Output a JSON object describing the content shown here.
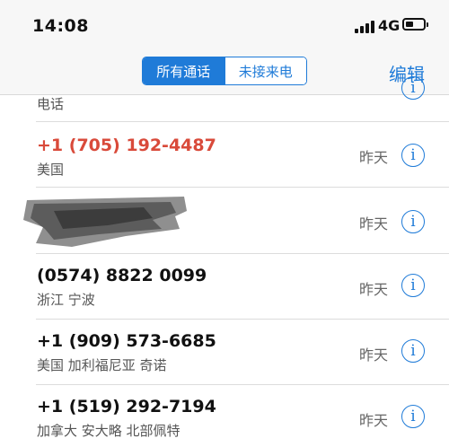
{
  "status_bar": {
    "time": "14:08",
    "network": "4G"
  },
  "nav": {
    "segments": [
      "所有通话",
      "未接来电"
    ],
    "edit_label": "编辑"
  },
  "calls": [
    {
      "number": "",
      "location": "电话",
      "when": "",
      "missed": false
    },
    {
      "number": "+1 (705) 192-4487",
      "location": "美国",
      "when": "昨天",
      "missed": true
    },
    {
      "number": "",
      "location": "",
      "when": "昨天",
      "missed": false
    },
    {
      "number": "(0574) 8822 0099",
      "location": "浙江 宁波",
      "when": "昨天",
      "missed": false
    },
    {
      "number": "+1 (909) 573-6685",
      "location": "美国 加利福尼亚 奇诺",
      "when": "昨天",
      "missed": false
    },
    {
      "number": "+1 (519) 292-7194",
      "location": "加拿大 安大略 北部佩特",
      "when": "昨天",
      "missed": false
    }
  ],
  "colors": {
    "accent": "#1f7bd8",
    "missed": "#d94a3a"
  }
}
